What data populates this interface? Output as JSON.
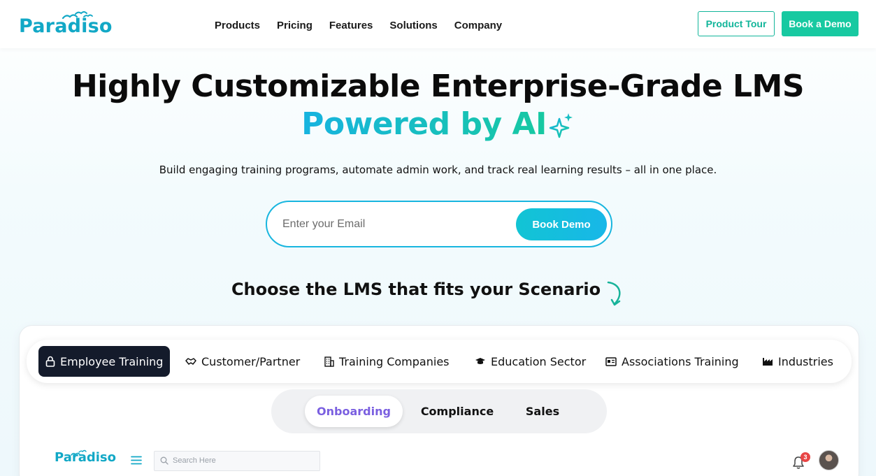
{
  "brand": {
    "name": "Paradiso",
    "color": "#12a8c6",
    "accent": "#17c9a1"
  },
  "nav": {
    "items": [
      "Products",
      "Pricing",
      "Features",
      "Solutions",
      "Company"
    ]
  },
  "header_buttons": {
    "tour": "Product Tour",
    "demo": "Book a Demo"
  },
  "hero": {
    "title_line1": "Highly Customizable Enterprise-Grade LMS",
    "title_line2": "Powered by AI",
    "subtitle": "Build engaging training programs, automate admin work, and track real learning results – all in one place.",
    "email_placeholder": "Enter your Email",
    "cta": "Book Demo"
  },
  "scenario": {
    "heading": "Choose the LMS that fits your Scenario",
    "tabs": [
      {
        "label": "Employee Training",
        "icon": "lock-icon",
        "active": true
      },
      {
        "label": "Customer/Partner",
        "icon": "handshake-icon",
        "active": false
      },
      {
        "label": "Training Companies",
        "icon": "building-icon",
        "active": false
      },
      {
        "label": "Education Sector",
        "icon": "graduation-cap-icon",
        "active": false
      },
      {
        "label": "Associations Training",
        "icon": "id-card-icon",
        "active": false
      },
      {
        "label": "Industries",
        "icon": "factory-icon",
        "active": false
      }
    ],
    "subtabs": [
      {
        "label": "Onboarding",
        "active": true
      },
      {
        "label": "Compliance",
        "active": false
      },
      {
        "label": "Sales",
        "active": false
      }
    ]
  },
  "preview": {
    "logo": "Paradiso",
    "search_placeholder": "Search Here",
    "notification_count": "3"
  }
}
